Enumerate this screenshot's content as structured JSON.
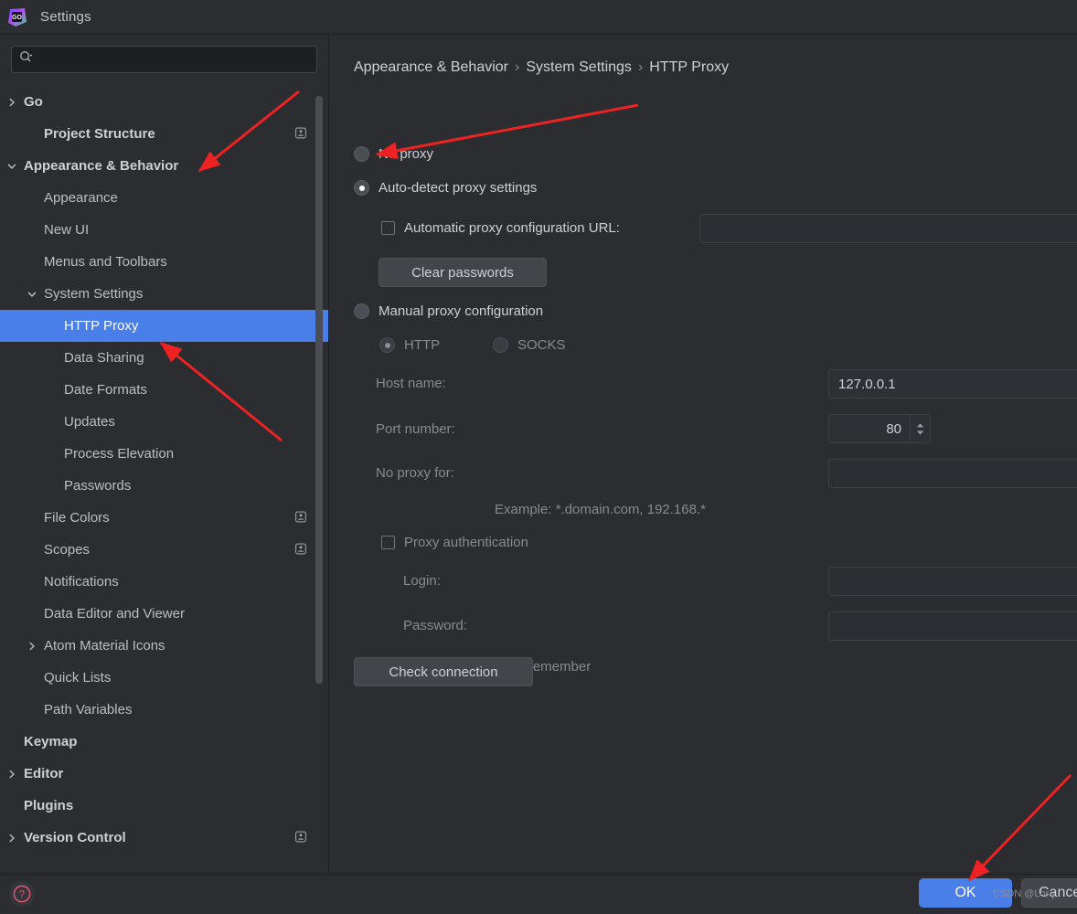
{
  "window": {
    "title": "Settings",
    "app_icon": "goland-logo-icon"
  },
  "sidebar": {
    "search": {
      "value": "",
      "placeholder": ""
    },
    "items": [
      {
        "label": "Go",
        "indent": 0,
        "arrow": "right",
        "bold": true,
        "badge": false,
        "selected": false
      },
      {
        "label": "Project Structure",
        "indent": 1,
        "arrow": "none",
        "bold": true,
        "badge": true,
        "selected": false
      },
      {
        "label": "Appearance & Behavior",
        "indent": 0,
        "arrow": "down",
        "bold": true,
        "badge": false,
        "selected": false
      },
      {
        "label": "Appearance",
        "indent": 1,
        "arrow": "none",
        "bold": false,
        "badge": false,
        "selected": false
      },
      {
        "label": "New UI",
        "indent": 1,
        "arrow": "none",
        "bold": false,
        "badge": false,
        "selected": false
      },
      {
        "label": "Menus and Toolbars",
        "indent": 1,
        "arrow": "none",
        "bold": false,
        "badge": false,
        "selected": false
      },
      {
        "label": "System Settings",
        "indent": 1,
        "arrow": "down",
        "bold": false,
        "badge": false,
        "selected": false
      },
      {
        "label": "HTTP Proxy",
        "indent": 2,
        "arrow": "none",
        "bold": false,
        "badge": false,
        "selected": true
      },
      {
        "label": "Data Sharing",
        "indent": 2,
        "arrow": "none",
        "bold": false,
        "badge": false,
        "selected": false
      },
      {
        "label": "Date Formats",
        "indent": 2,
        "arrow": "none",
        "bold": false,
        "badge": false,
        "selected": false
      },
      {
        "label": "Updates",
        "indent": 2,
        "arrow": "none",
        "bold": false,
        "badge": false,
        "selected": false
      },
      {
        "label": "Process Elevation",
        "indent": 2,
        "arrow": "none",
        "bold": false,
        "badge": false,
        "selected": false
      },
      {
        "label": "Passwords",
        "indent": 2,
        "arrow": "none",
        "bold": false,
        "badge": false,
        "selected": false
      },
      {
        "label": "File Colors",
        "indent": 1,
        "arrow": "none",
        "bold": false,
        "badge": true,
        "selected": false
      },
      {
        "label": "Scopes",
        "indent": 1,
        "arrow": "none",
        "bold": false,
        "badge": true,
        "selected": false
      },
      {
        "label": "Notifications",
        "indent": 1,
        "arrow": "none",
        "bold": false,
        "badge": false,
        "selected": false
      },
      {
        "label": "Data Editor and Viewer",
        "indent": 1,
        "arrow": "none",
        "bold": false,
        "badge": false,
        "selected": false
      },
      {
        "label": "Atom Material Icons",
        "indent": 1,
        "arrow": "right",
        "bold": false,
        "badge": false,
        "selected": false
      },
      {
        "label": "Quick Lists",
        "indent": 1,
        "arrow": "none",
        "bold": false,
        "badge": false,
        "selected": false
      },
      {
        "label": "Path Variables",
        "indent": 1,
        "arrow": "none",
        "bold": false,
        "badge": false,
        "selected": false
      },
      {
        "label": "Keymap",
        "indent": 0,
        "arrow": "none",
        "bold": true,
        "badge": false,
        "selected": false
      },
      {
        "label": "Editor",
        "indent": 0,
        "arrow": "right",
        "bold": true,
        "badge": false,
        "selected": false
      },
      {
        "label": "Plugins",
        "indent": 0,
        "arrow": "none",
        "bold": true,
        "badge": false,
        "selected": false
      },
      {
        "label": "Version Control",
        "indent": 0,
        "arrow": "right",
        "bold": true,
        "badge": true,
        "selected": false
      }
    ]
  },
  "main": {
    "breadcrumb": {
      "parts": [
        "Appearance & Behavior",
        "System Settings",
        "HTTP Proxy"
      ],
      "separator": "›"
    },
    "proxy_mode": "auto-detect",
    "options": {
      "no_proxy": {
        "label": "No proxy",
        "selected": false
      },
      "auto_detect": {
        "label": "Auto-detect proxy settings",
        "selected": true
      },
      "manual": {
        "label": "Manual proxy configuration",
        "selected": false
      }
    },
    "auto_pac": {
      "label": "Automatic proxy configuration URL:",
      "checked": false,
      "value": ""
    },
    "clear_passwords_label": "Clear passwords",
    "protocol": {
      "http": {
        "label": "HTTP",
        "selected": true
      },
      "socks": {
        "label": "SOCKS",
        "selected": false
      }
    },
    "host_name": {
      "label": "Host name:",
      "value": "127.0.0.1"
    },
    "port_number": {
      "label": "Port number:",
      "value": "80"
    },
    "no_proxy_for": {
      "label": "No proxy for:",
      "value": ""
    },
    "example_hint": "Example: *.domain.com, 192.168.*",
    "proxy_auth": {
      "label": "Proxy authentication",
      "checked": false
    },
    "login": {
      "label": "Login:",
      "value": ""
    },
    "password": {
      "label": "Password:",
      "value": ""
    },
    "remember": {
      "label": "Remember",
      "checked": false
    },
    "check_connection_label": "Check connection"
  },
  "bottom": {
    "help_icon": "question-mark-icon",
    "ok_label": "OK",
    "cancel_label": "Cancel",
    "watermark": "CSDN @Lor·j"
  },
  "colors": {
    "accent": "#4a7ee8",
    "background": "#2b2d30",
    "field_background": "#2e3035",
    "text": "#ced0d6",
    "text_dim": "#868a91",
    "annotation": "#ee2222",
    "help_icon": "#e2566e"
  }
}
